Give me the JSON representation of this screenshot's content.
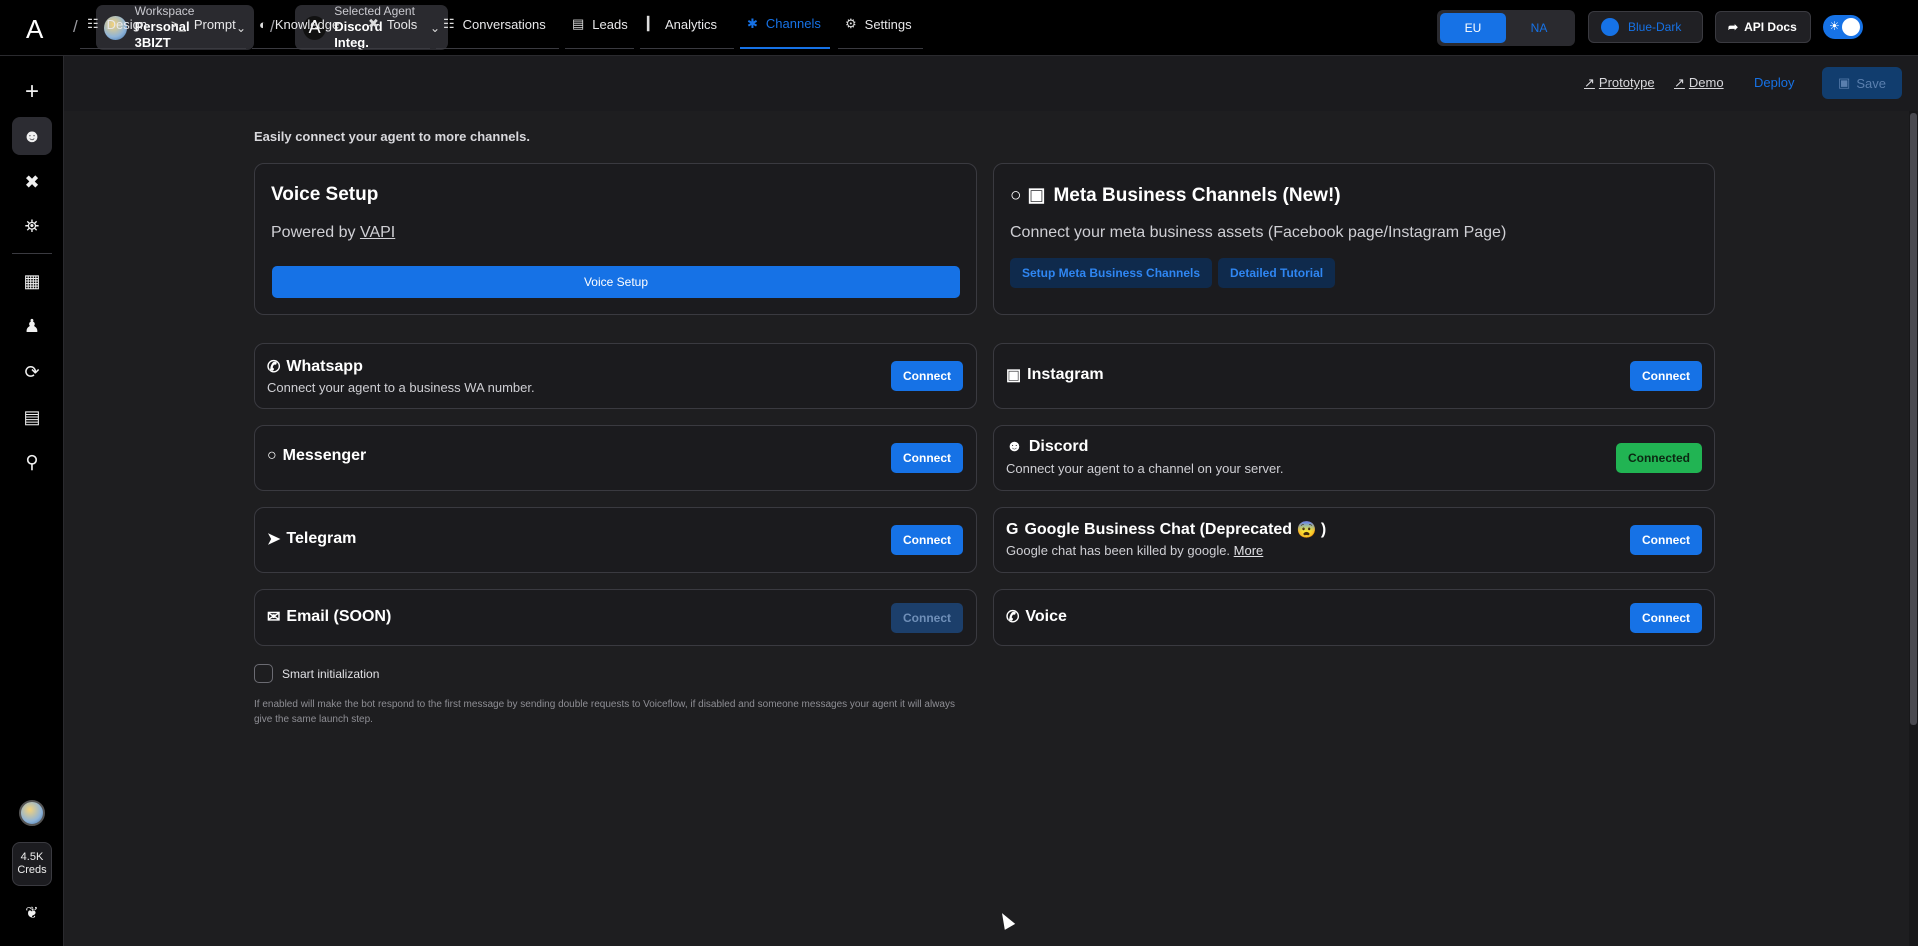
{
  "topbar": {
    "logo": "A",
    "workspace": {
      "label": "Workspace",
      "value": "Personal 3BIZT"
    },
    "agent": {
      "label": "Selected Agent",
      "value": "Discord Integ."
    },
    "regions": [
      "EU",
      "NA"
    ],
    "theme": "Blue-Dark",
    "api_docs": "API Docs"
  },
  "tabs": [
    {
      "label": "Design",
      "icon": "robot-icon"
    },
    {
      "label": "Prompt",
      "icon": "terminal-icon"
    },
    {
      "label": "Knowledge",
      "icon": "book-icon"
    },
    {
      "label": "Tools",
      "icon": "tools-icon"
    },
    {
      "label": "Conversations",
      "icon": "chat-robot-icon"
    },
    {
      "label": "Leads",
      "icon": "contact-icon"
    },
    {
      "label": "Analytics",
      "icon": "bar-chart-icon"
    },
    {
      "label": "Channels",
      "icon": "plug-icon"
    },
    {
      "label": "Settings",
      "icon": "gear-icon"
    }
  ],
  "actions": {
    "prototype": "Prototype",
    "demo": "Demo",
    "deploy": "Deploy",
    "save": "Save"
  },
  "intro": "Easily connect your agent to more channels.",
  "voice_setup": {
    "title": "Voice Setup",
    "powered_by": "Powered by",
    "vapi": "VAPI",
    "button": "Voice Setup"
  },
  "meta": {
    "title": "Meta Business Channels (New!)",
    "desc": "Connect your meta business assets (Facebook page/Instagram Page)",
    "setup_btn": "Setup Meta Business Channels",
    "tutorial_btn": "Detailed Tutorial"
  },
  "channels": {
    "whatsapp": {
      "name": "Whatsapp",
      "desc": "Connect your agent to a business WA number.",
      "btn": "Connect"
    },
    "instagram": {
      "name": "Instagram",
      "btn": "Connect"
    },
    "messenger": {
      "name": "Messenger",
      "btn": "Connect"
    },
    "discord": {
      "name": "Discord",
      "desc": "Connect your agent to a channel on your server.",
      "btn": "Connected"
    },
    "telegram": {
      "name": "Telegram",
      "btn": "Connect"
    },
    "google": {
      "name": "Google Business Chat (Deprecated",
      "emoji": "😨",
      "close": ")",
      "desc": "Google chat has been killed by google.",
      "more": "More",
      "btn": "Connect"
    },
    "email": {
      "name": "Email (SOON)",
      "btn": "Connect"
    },
    "voice": {
      "name": "Voice",
      "btn": "Connect"
    }
  },
  "smart_init": {
    "label": "Smart initialization",
    "note": "If enabled will make the bot respond to the first message by sending double requests to Voiceflow, if disabled and someone messages your agent it will always give the same launch step."
  },
  "sidebar": {
    "creds_value": "4.5K",
    "creds_label": "Creds"
  },
  "colors": {
    "accent": "#1672e6",
    "success": "#21b453",
    "background": "#1e1e20"
  }
}
